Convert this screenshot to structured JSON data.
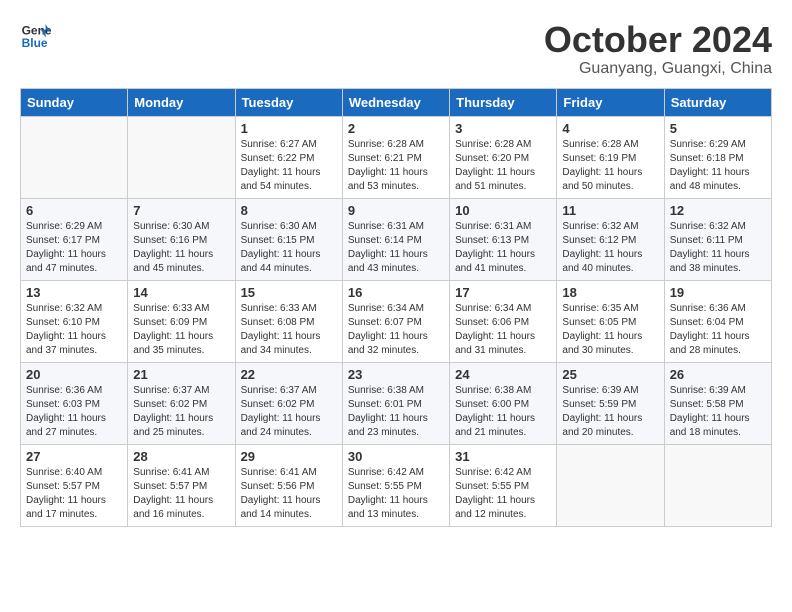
{
  "header": {
    "logo_line1": "General",
    "logo_line2": "Blue",
    "month": "October 2024",
    "location": "Guanyang, Guangxi, China"
  },
  "days_of_week": [
    "Sunday",
    "Monday",
    "Tuesday",
    "Wednesday",
    "Thursday",
    "Friday",
    "Saturday"
  ],
  "weeks": [
    [
      {
        "day": "",
        "sunrise": "",
        "sunset": "",
        "daylight": ""
      },
      {
        "day": "",
        "sunrise": "",
        "sunset": "",
        "daylight": ""
      },
      {
        "day": "1",
        "sunrise": "Sunrise: 6:27 AM",
        "sunset": "Sunset: 6:22 PM",
        "daylight": "Daylight: 11 hours and 54 minutes."
      },
      {
        "day": "2",
        "sunrise": "Sunrise: 6:28 AM",
        "sunset": "Sunset: 6:21 PM",
        "daylight": "Daylight: 11 hours and 53 minutes."
      },
      {
        "day": "3",
        "sunrise": "Sunrise: 6:28 AM",
        "sunset": "Sunset: 6:20 PM",
        "daylight": "Daylight: 11 hours and 51 minutes."
      },
      {
        "day": "4",
        "sunrise": "Sunrise: 6:28 AM",
        "sunset": "Sunset: 6:19 PM",
        "daylight": "Daylight: 11 hours and 50 minutes."
      },
      {
        "day": "5",
        "sunrise": "Sunrise: 6:29 AM",
        "sunset": "Sunset: 6:18 PM",
        "daylight": "Daylight: 11 hours and 48 minutes."
      }
    ],
    [
      {
        "day": "6",
        "sunrise": "Sunrise: 6:29 AM",
        "sunset": "Sunset: 6:17 PM",
        "daylight": "Daylight: 11 hours and 47 minutes."
      },
      {
        "day": "7",
        "sunrise": "Sunrise: 6:30 AM",
        "sunset": "Sunset: 6:16 PM",
        "daylight": "Daylight: 11 hours and 45 minutes."
      },
      {
        "day": "8",
        "sunrise": "Sunrise: 6:30 AM",
        "sunset": "Sunset: 6:15 PM",
        "daylight": "Daylight: 11 hours and 44 minutes."
      },
      {
        "day": "9",
        "sunrise": "Sunrise: 6:31 AM",
        "sunset": "Sunset: 6:14 PM",
        "daylight": "Daylight: 11 hours and 43 minutes."
      },
      {
        "day": "10",
        "sunrise": "Sunrise: 6:31 AM",
        "sunset": "Sunset: 6:13 PM",
        "daylight": "Daylight: 11 hours and 41 minutes."
      },
      {
        "day": "11",
        "sunrise": "Sunrise: 6:32 AM",
        "sunset": "Sunset: 6:12 PM",
        "daylight": "Daylight: 11 hours and 40 minutes."
      },
      {
        "day": "12",
        "sunrise": "Sunrise: 6:32 AM",
        "sunset": "Sunset: 6:11 PM",
        "daylight": "Daylight: 11 hours and 38 minutes."
      }
    ],
    [
      {
        "day": "13",
        "sunrise": "Sunrise: 6:32 AM",
        "sunset": "Sunset: 6:10 PM",
        "daylight": "Daylight: 11 hours and 37 minutes."
      },
      {
        "day": "14",
        "sunrise": "Sunrise: 6:33 AM",
        "sunset": "Sunset: 6:09 PM",
        "daylight": "Daylight: 11 hours and 35 minutes."
      },
      {
        "day": "15",
        "sunrise": "Sunrise: 6:33 AM",
        "sunset": "Sunset: 6:08 PM",
        "daylight": "Daylight: 11 hours and 34 minutes."
      },
      {
        "day": "16",
        "sunrise": "Sunrise: 6:34 AM",
        "sunset": "Sunset: 6:07 PM",
        "daylight": "Daylight: 11 hours and 32 minutes."
      },
      {
        "day": "17",
        "sunrise": "Sunrise: 6:34 AM",
        "sunset": "Sunset: 6:06 PM",
        "daylight": "Daylight: 11 hours and 31 minutes."
      },
      {
        "day": "18",
        "sunrise": "Sunrise: 6:35 AM",
        "sunset": "Sunset: 6:05 PM",
        "daylight": "Daylight: 11 hours and 30 minutes."
      },
      {
        "day": "19",
        "sunrise": "Sunrise: 6:36 AM",
        "sunset": "Sunset: 6:04 PM",
        "daylight": "Daylight: 11 hours and 28 minutes."
      }
    ],
    [
      {
        "day": "20",
        "sunrise": "Sunrise: 6:36 AM",
        "sunset": "Sunset: 6:03 PM",
        "daylight": "Daylight: 11 hours and 27 minutes."
      },
      {
        "day": "21",
        "sunrise": "Sunrise: 6:37 AM",
        "sunset": "Sunset: 6:02 PM",
        "daylight": "Daylight: 11 hours and 25 minutes."
      },
      {
        "day": "22",
        "sunrise": "Sunrise: 6:37 AM",
        "sunset": "Sunset: 6:02 PM",
        "daylight": "Daylight: 11 hours and 24 minutes."
      },
      {
        "day": "23",
        "sunrise": "Sunrise: 6:38 AM",
        "sunset": "Sunset: 6:01 PM",
        "daylight": "Daylight: 11 hours and 23 minutes."
      },
      {
        "day": "24",
        "sunrise": "Sunrise: 6:38 AM",
        "sunset": "Sunset: 6:00 PM",
        "daylight": "Daylight: 11 hours and 21 minutes."
      },
      {
        "day": "25",
        "sunrise": "Sunrise: 6:39 AM",
        "sunset": "Sunset: 5:59 PM",
        "daylight": "Daylight: 11 hours and 20 minutes."
      },
      {
        "day": "26",
        "sunrise": "Sunrise: 6:39 AM",
        "sunset": "Sunset: 5:58 PM",
        "daylight": "Daylight: 11 hours and 18 minutes."
      }
    ],
    [
      {
        "day": "27",
        "sunrise": "Sunrise: 6:40 AM",
        "sunset": "Sunset: 5:57 PM",
        "daylight": "Daylight: 11 hours and 17 minutes."
      },
      {
        "day": "28",
        "sunrise": "Sunrise: 6:41 AM",
        "sunset": "Sunset: 5:57 PM",
        "daylight": "Daylight: 11 hours and 16 minutes."
      },
      {
        "day": "29",
        "sunrise": "Sunrise: 6:41 AM",
        "sunset": "Sunset: 5:56 PM",
        "daylight": "Daylight: 11 hours and 14 minutes."
      },
      {
        "day": "30",
        "sunrise": "Sunrise: 6:42 AM",
        "sunset": "Sunset: 5:55 PM",
        "daylight": "Daylight: 11 hours and 13 minutes."
      },
      {
        "day": "31",
        "sunrise": "Sunrise: 6:42 AM",
        "sunset": "Sunset: 5:55 PM",
        "daylight": "Daylight: 11 hours and 12 minutes."
      },
      {
        "day": "",
        "sunrise": "",
        "sunset": "",
        "daylight": ""
      },
      {
        "day": "",
        "sunrise": "",
        "sunset": "",
        "daylight": ""
      }
    ]
  ]
}
